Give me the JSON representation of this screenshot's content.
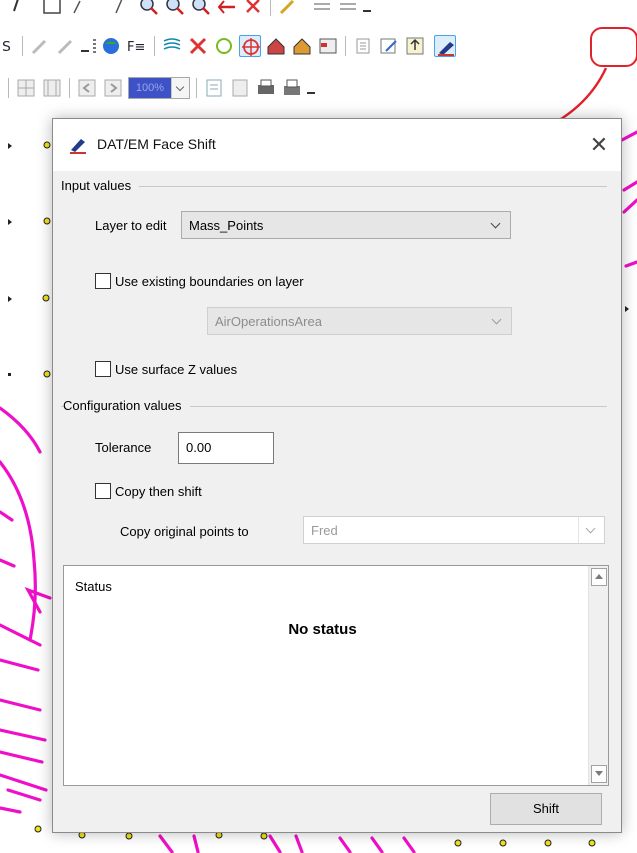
{
  "dialog": {
    "title": "DAT/EM Face Shift",
    "close_symbol": "✕",
    "input_group": {
      "label": "Input values",
      "layer_label": "Layer to edit",
      "layer_value": "Mass_Points",
      "use_boundaries_label": "Use existing boundaries on layer",
      "use_boundaries_checked": false,
      "boundary_layer_value": "AirOperationsArea",
      "use_surface_z_label": "Use surface Z values",
      "use_surface_z_checked": false
    },
    "config_group": {
      "label": "Configuration values",
      "tolerance_label": "Tolerance",
      "tolerance_value": "0.00",
      "copy_then_shift_label": "Copy then shift",
      "copy_then_shift_checked": false,
      "copy_to_label": "Copy original points to",
      "copy_to_value": "Fred"
    },
    "status": {
      "title": "Status",
      "message": "No status"
    },
    "shift_button_label": "Shift"
  },
  "toolbar": {
    "zoom_value": "100%",
    "highlighted_tool": "face-shift-icon",
    "annotation_color": "#e0222c"
  },
  "colors": {
    "magenta_lines": "#ee10c8",
    "point_fill": "#f3e21b",
    "zoom_highlight": "#3c52c6"
  }
}
